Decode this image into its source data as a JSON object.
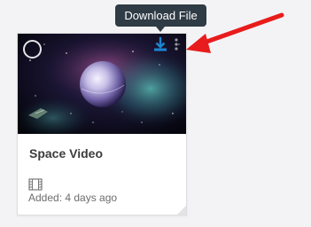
{
  "tooltip": {
    "text": "Download File"
  },
  "card": {
    "title": "Space Video",
    "added": "Added: 4 days ago",
    "thumbnail_icon": "space-planet-image",
    "type_icon": "film-icon",
    "actions": {
      "download_icon": "download-icon",
      "more_icon": "more-vertical-icon",
      "select_icon": "select-circle-icon"
    }
  },
  "colors": {
    "background": "#f3f3f5",
    "tooltip_bg": "#2f3b45",
    "accent_blue": "#1c86d1",
    "annotation_red": "#e81c1c"
  }
}
